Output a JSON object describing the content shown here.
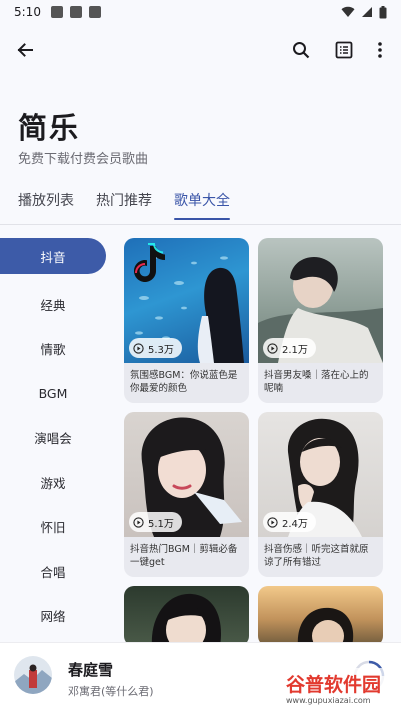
{
  "status": {
    "time": "5:10"
  },
  "app": {
    "title": "简乐",
    "subtitle": "免费下载付费会员歌曲"
  },
  "tabs": [
    {
      "label": "播放列表"
    },
    {
      "label": "热门推荐"
    },
    {
      "label": "歌单大全",
      "active": true
    }
  ],
  "categories": [
    {
      "label": "抖音",
      "active": true
    },
    {
      "label": "经典"
    },
    {
      "label": "情歌"
    },
    {
      "label": "BGM"
    },
    {
      "label": "演唱会"
    },
    {
      "label": "游戏"
    },
    {
      "label": "怀旧"
    },
    {
      "label": "合唱"
    },
    {
      "label": "网络"
    }
  ],
  "playlists": [
    {
      "plays": "5.3万",
      "title": "氛围感BGM：你说蓝色是你最爱的颜色"
    },
    {
      "plays": "2.1万",
      "title": "抖音男友嗓｜落在心上的呢喃"
    },
    {
      "plays": "5.1万",
      "title": "抖音热门BGM｜剪辑必备一键get"
    },
    {
      "plays": "2.4万",
      "title": "抖音伤感｜听完这首就原谅了所有错过"
    },
    {
      "plays": "",
      "title": ""
    },
    {
      "plays": "",
      "title": ""
    }
  ],
  "player": {
    "song": "春庭雪",
    "artist": "邓寓君(等什么君)"
  },
  "watermark": {
    "line1": "谷普软件园",
    "line2": "www.gupuxiazai.com"
  },
  "colors": {
    "accent": "#3d5ba8"
  }
}
